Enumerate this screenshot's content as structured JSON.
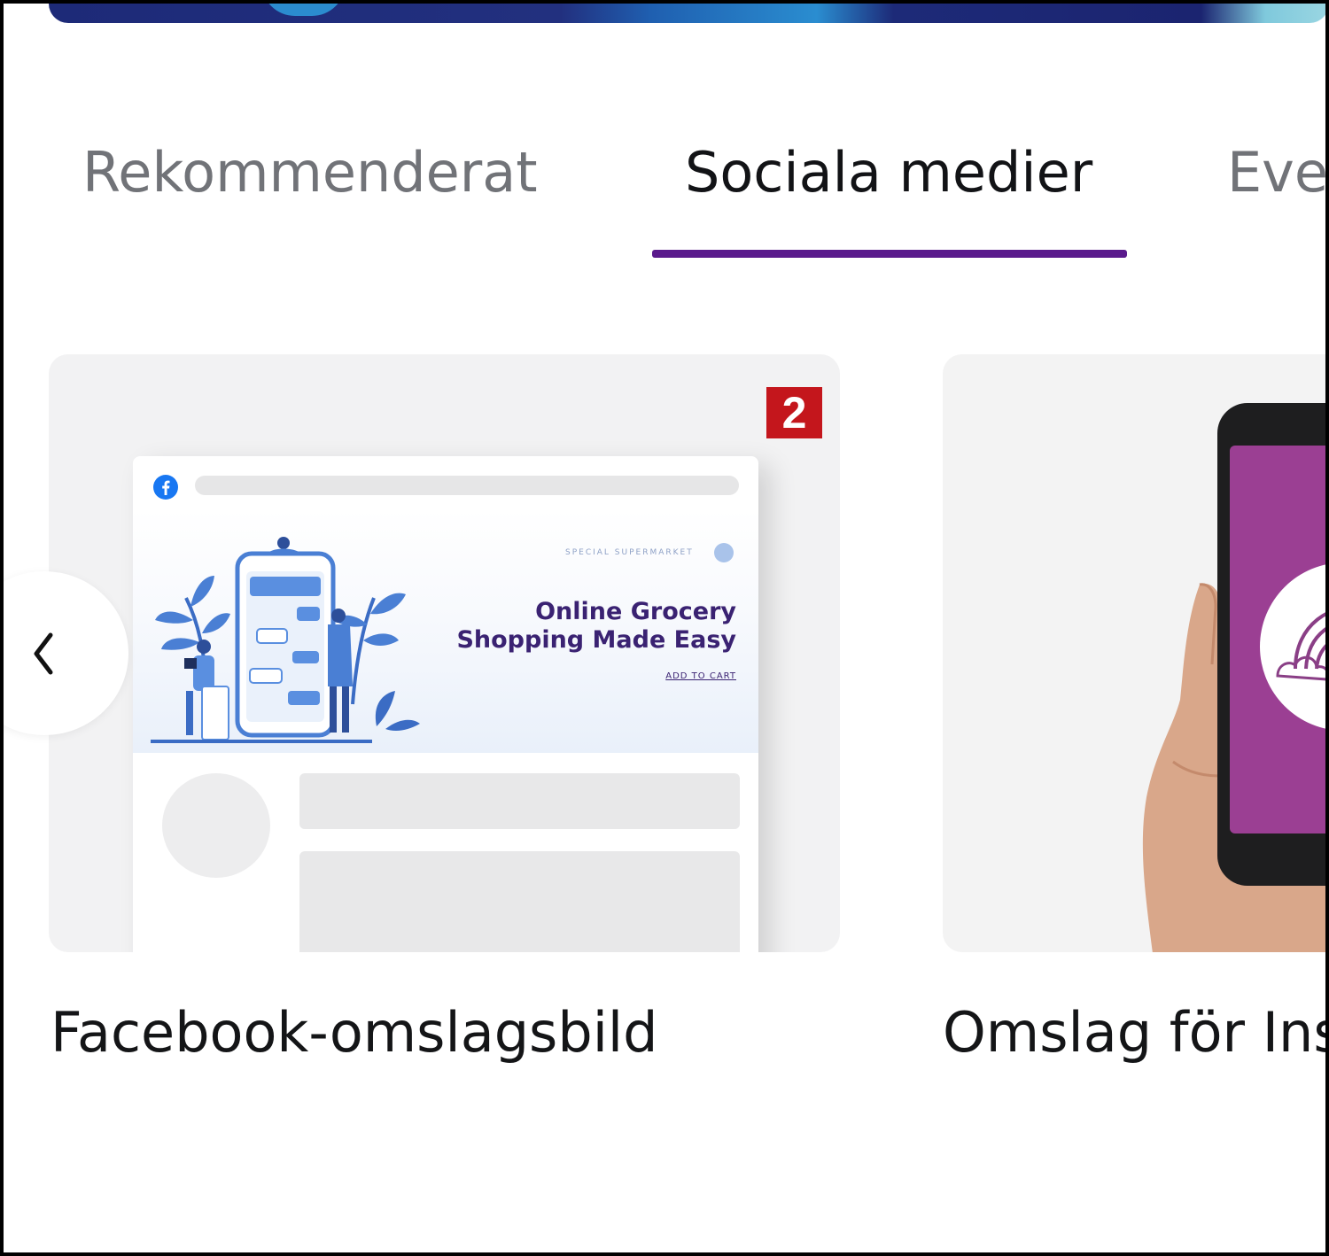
{
  "tabs": [
    {
      "label": "Rekommenderat",
      "active": false
    },
    {
      "label": "Sociala medier",
      "active": true
    },
    {
      "label": "Eve",
      "active": false
    }
  ],
  "colors": {
    "accent": "#5a1a8c",
    "badge": "#c4161c",
    "instagram_screen": "#9b3f93",
    "facebook_blue": "#1877f2"
  },
  "cards": [
    {
      "caption": "Facebook-omslagsbild",
      "badge": "2",
      "preview": {
        "headline_line1": "Online Grocery",
        "headline_line2": "Shopping Made Easy",
        "small_brand": "SPECIAL SUPERMARKET",
        "link_text": "ADD TO CART"
      }
    },
    {
      "caption": "Omslag för Ins"
    }
  ],
  "icons": {
    "prev": "chevron-left-icon",
    "facebook": "facebook-icon"
  }
}
